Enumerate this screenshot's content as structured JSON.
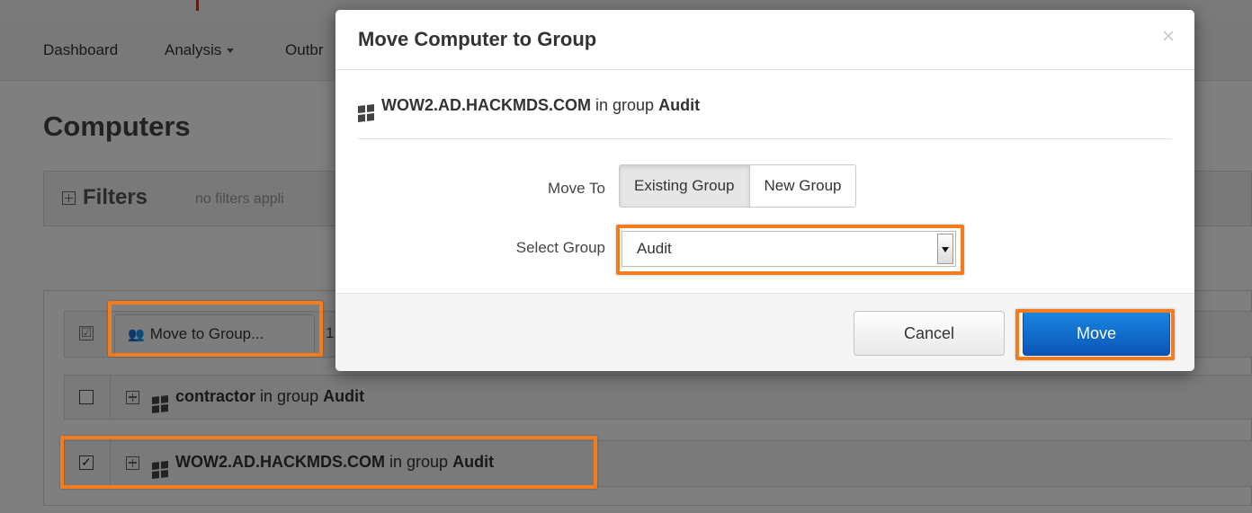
{
  "nav": {
    "dashboard": "Dashboard",
    "analysis": "Analysis",
    "outbreak_partial": "Outbr"
  },
  "page": {
    "title": "Computers",
    "filters_label": "Filters",
    "filters_note": "no filters appli"
  },
  "toolbar": {
    "move_to_group": "Move to Group...",
    "extra_partial": "1"
  },
  "rows": [
    {
      "name": "contractor",
      "in_group_text": "in group",
      "group": "Audit",
      "checked": false
    },
    {
      "name": "WOW2.AD.HACKMDS.COM",
      "in_group_text": "in group",
      "group": "Audit",
      "checked": true
    }
  ],
  "modal": {
    "title": "Move Computer to Group",
    "close_glyph": "×",
    "computer_name": "WOW2.AD.HACKMDS.COM",
    "in_group_text": "in group",
    "current_group": "Audit",
    "move_to_label": "Move To",
    "options": [
      "Existing Group",
      "New Group"
    ],
    "selected_option": "Existing Group",
    "select_group_label": "Select Group",
    "select_group_value": "Audit",
    "cancel_label": "Cancel",
    "move_label": "Move"
  },
  "colors": {
    "highlight": "#f47c1c",
    "primary_button": "#0a6fd0",
    "overlay": "rgba(0,0,0,0.5)"
  },
  "icons": [
    "windows-icon",
    "users-icon",
    "plus-square-icon",
    "close-icon",
    "checkbox-icon",
    "dropdown-arrow-icon"
  ]
}
